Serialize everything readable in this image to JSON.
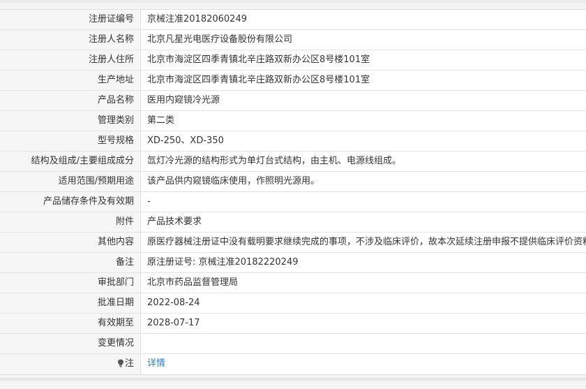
{
  "rows": [
    {
      "label": "注册证编号",
      "value": "京械注准20182060249"
    },
    {
      "label": "注册人名称",
      "value": "北京凡星光电医疗设备股份有限公司"
    },
    {
      "label": "注册人住所",
      "value": "北京市海淀区四季青镇北辛庄路双新办公区8号楼101室"
    },
    {
      "label": "生产地址",
      "value": "北京市海淀区四季青镇北辛庄路双新办公区8号楼101室"
    },
    {
      "label": "产品名称",
      "value": "医用内窥镜冷光源"
    },
    {
      "label": "管理类别",
      "value": "第二类"
    },
    {
      "label": "型号规格",
      "value": "XD-250、XD-350"
    },
    {
      "label": "结构及组成/主要组成成分",
      "value": "氙灯冷光源的结构形式为单灯台式结构，由主机、电源线组成。"
    },
    {
      "label": "适用范围/预期用途",
      "value": "该产品供内窥镜临床使用，作照明光源用。"
    },
    {
      "label": "产品储存条件及有效期",
      "value": "-"
    },
    {
      "label": "附件",
      "value": "产品技术要求"
    },
    {
      "label": "其他内容",
      "value": "原医疗器械注册证中没有载明要求继续完成的事项，不涉及临床评价，故本次延续注册申报不提供临床评价资料"
    },
    {
      "label": "备注",
      "value": "原注册证号: 京械注准20182220249"
    },
    {
      "label": "审批部门",
      "value": "北京市药品监督管理局"
    },
    {
      "label": "批准日期",
      "value": "2022-08-24"
    },
    {
      "label": "有效期至",
      "value": "2028-07-17"
    },
    {
      "label": "变更情况",
      "value": ""
    }
  ],
  "note": {
    "icon": "lightbulb-icon",
    "label": "注",
    "link_text": "详情"
  },
  "colors": {
    "label_bg": "#f6f6f6",
    "border": "#e3e3e3",
    "link": "#2b7fd1",
    "text": "#333333"
  }
}
